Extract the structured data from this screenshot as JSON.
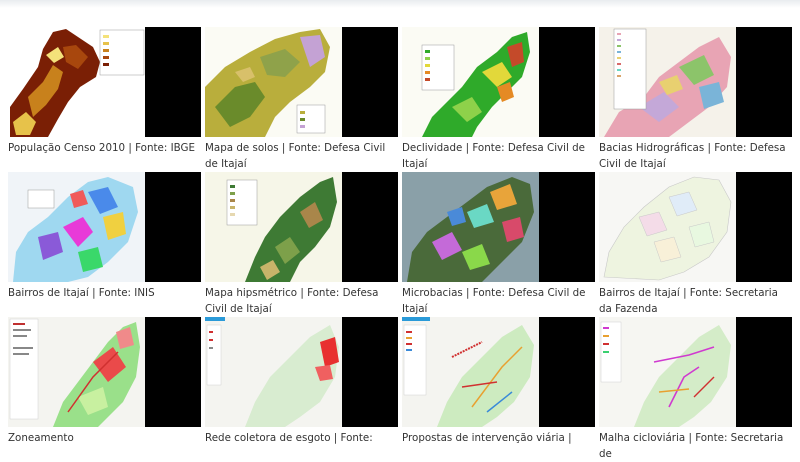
{
  "gallery": {
    "items": [
      {
        "caption": "População Censo 2010 | Fonte: IBGE",
        "map_style": "population"
      },
      {
        "caption": "Mapa de solos | Fonte: Defesa Civil de Itajaí",
        "map_style": "soils"
      },
      {
        "caption": "Declividade | Fonte: Defesa Civil de Itajaí",
        "map_style": "slope"
      },
      {
        "caption": "Bacias Hidrográficas | Fonte: Defesa Civil de Itajaí",
        "map_style": "basins"
      },
      {
        "caption": "Bairros de Itajaí | Fonte: INIS",
        "map_style": "neighborhoods"
      },
      {
        "caption": "Mapa hipsmétrico | Fonte: Defesa Civil de Itajaí",
        "map_style": "hypsometric"
      },
      {
        "caption": "Microbacias | Fonte: Defesa Civil de Itajaí",
        "map_style": "microbasins"
      },
      {
        "caption": "Bairros de Itajaí | Fonte: Secretaria da Fazenda",
        "map_style": "neighborhoods-pale"
      },
      {
        "caption": "Zoneamento",
        "map_style": "zoning"
      },
      {
        "caption": "Rede coletora de esgoto | Fonte:",
        "map_style": "sewer"
      },
      {
        "caption": "Propostas de intervenção viária |",
        "map_style": "roads"
      },
      {
        "caption": "Malha cicloviária | Fonte: Secretaria de",
        "map_style": "cycle"
      }
    ]
  }
}
